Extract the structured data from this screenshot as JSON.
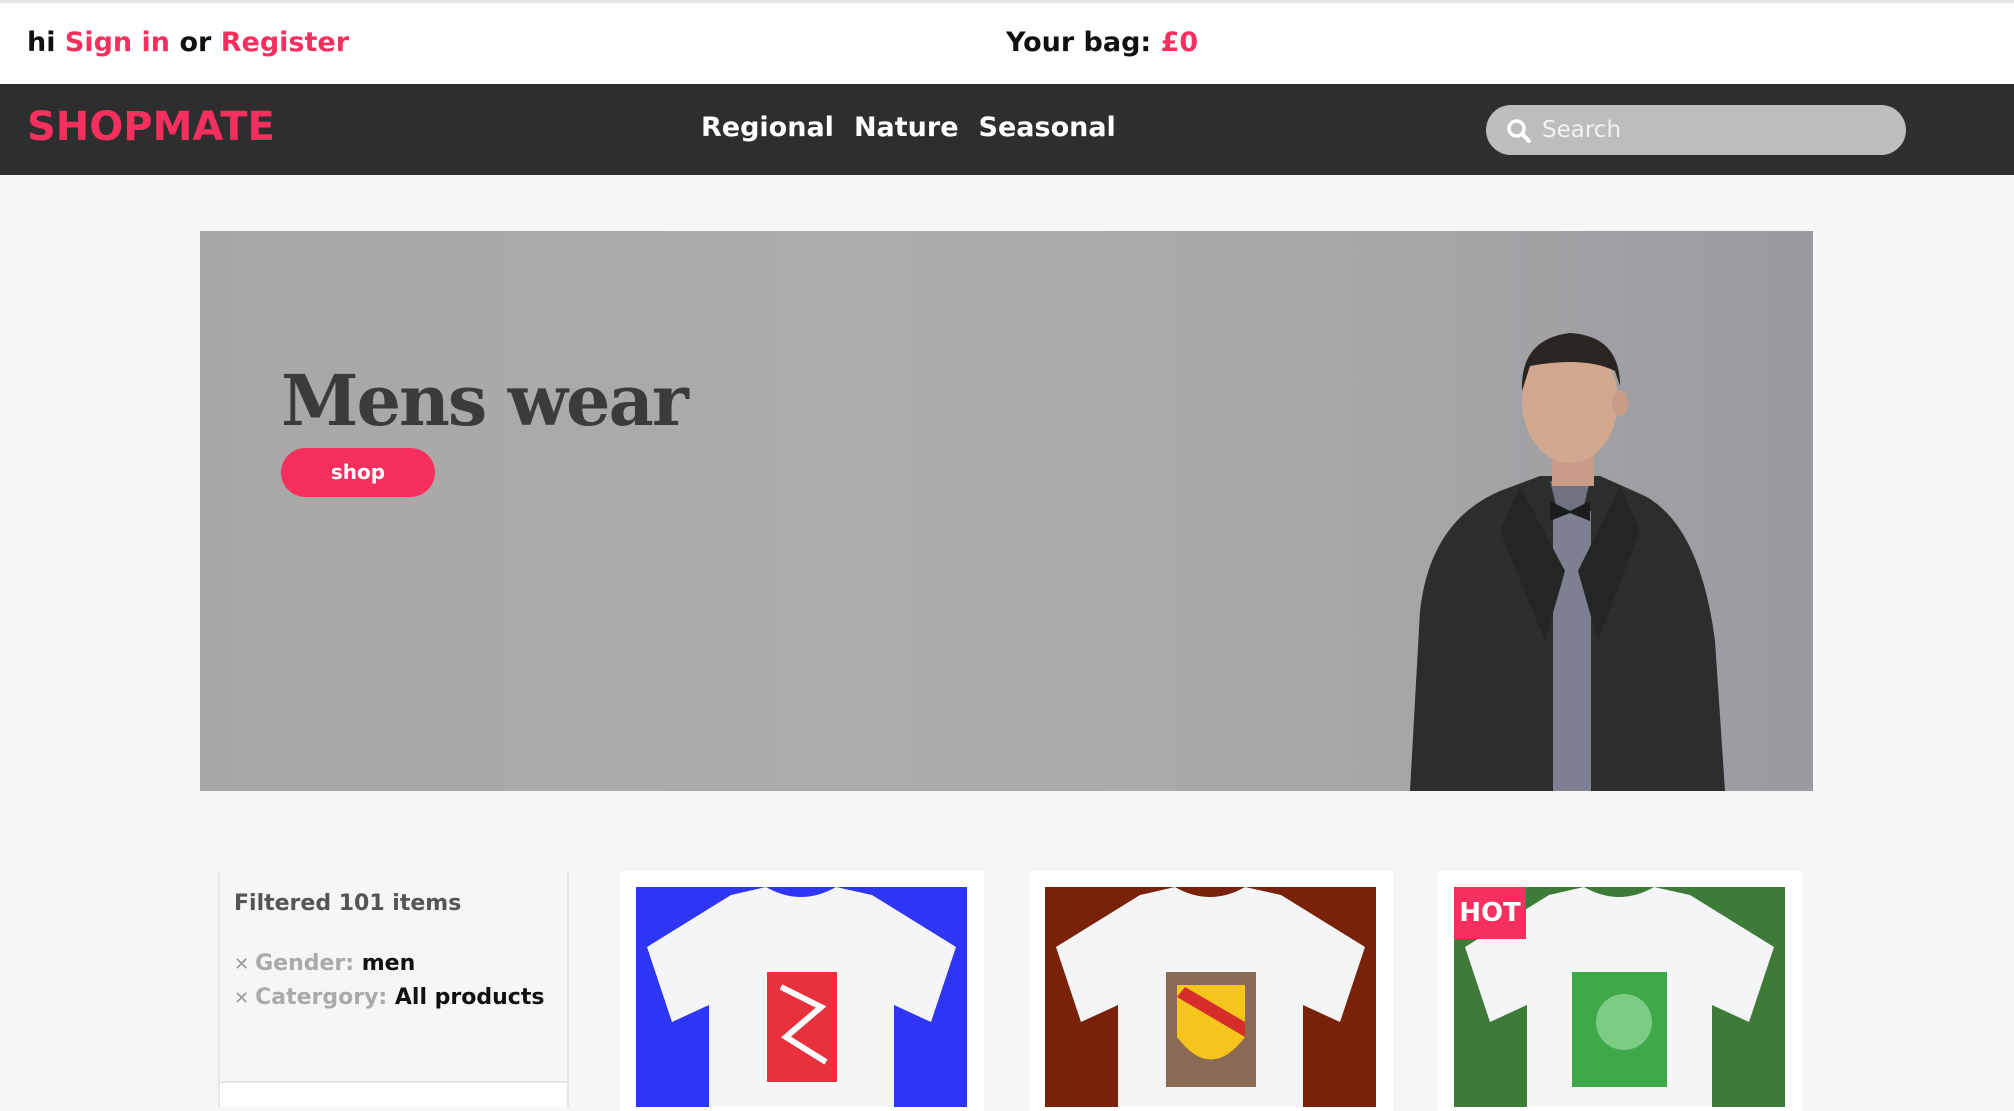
{
  "topbar": {
    "greeting": "hi",
    "sign_in": "Sign in",
    "or": "or",
    "register": "Register",
    "bag_label": "Your bag:",
    "bag_amount": "£0"
  },
  "navbar": {
    "logo": "SHOPMATE",
    "menu": [
      "Regional",
      "Nature",
      "Seasonal"
    ],
    "search_placeholder": "Search"
  },
  "hero": {
    "title": "Mens wear",
    "button": "shop"
  },
  "filters": {
    "count": "Filtered 101 items",
    "items": [
      {
        "key": "Gender:",
        "value": "men"
      },
      {
        "key": "Catergory:",
        "value": "All products"
      }
    ]
  },
  "products": [
    {
      "badge": "",
      "bg": "#2f35f5",
      "stamp": "#e8313c"
    },
    {
      "badge": "",
      "bg": "#7a2209",
      "stamp": "#f5c51b"
    },
    {
      "badge": "HOT",
      "bg": "#3e7a38",
      "stamp": "#3fa94a"
    }
  ],
  "colors": {
    "accent": "#f62f5e",
    "navbar": "#2e2e2e"
  }
}
